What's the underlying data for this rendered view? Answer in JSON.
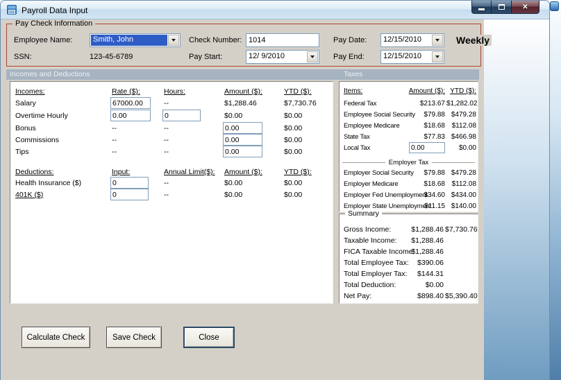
{
  "window": {
    "title": "Payroll Data Input"
  },
  "colors": {
    "form_background": "#d4d0c8",
    "paycheck_group_border": "#a94432",
    "section_header_background": "#a6b4c1",
    "combo_selection": "#2e5cc5"
  },
  "paycheck": {
    "group_label": "Pay Check Information",
    "employee_name": {
      "label": "Employee Name:",
      "value": "Smith, John"
    },
    "ssn": {
      "label": "SSN:",
      "value": "123-45-6789"
    },
    "check_number": {
      "label": "Check Number:",
      "value": "1014"
    },
    "pay_start": {
      "label": "Pay Start:",
      "value": "12/ 9/2010"
    },
    "pay_date": {
      "label": "Pay Date:",
      "value": "12/15/2010"
    },
    "pay_end": {
      "label": "Pay End:",
      "value": "12/15/2010"
    },
    "frequency": "Weekly"
  },
  "section_headers": {
    "incomes_deductions": "Incomes and Deductions",
    "taxes": "Taxes"
  },
  "incomes": {
    "col_headers": {
      "name": "Incomes:",
      "rate": "Rate ($):",
      "hours": "Hours:",
      "amount": "Amount ($):",
      "ytd": "YTD ($):"
    },
    "salary": {
      "label": "Salary",
      "rate": "67000.00",
      "hours": "--",
      "amount": "$1,288.46",
      "ytd": "$7,730.76"
    },
    "overtime": {
      "label": "Overtime Hourly",
      "rate": "0.00",
      "hours": "0",
      "amount": "$0.00",
      "ytd": "$0.00"
    },
    "bonus": {
      "label": "Bonus",
      "rate": "--",
      "hours": "--",
      "amount": "0.00",
      "ytd": "$0.00"
    },
    "commissions": {
      "label": "Commissions",
      "rate": "--",
      "hours": "--",
      "amount": "0.00",
      "ytd": "$0.00"
    },
    "tips": {
      "label": "Tips",
      "rate": "--",
      "hours": "--",
      "amount": "0.00",
      "ytd": "$0.00"
    }
  },
  "deductions": {
    "col_headers": {
      "name": "Deductions:",
      "input": "Input:",
      "limit": "Annual Limit($):",
      "amount": "Amount ($):",
      "ytd": "YTD ($):"
    },
    "health_insurance": {
      "label": "Health Insurance  ($)",
      "input": "0",
      "limit": "--",
      "amount": "$0.00",
      "ytd": "$0.00"
    },
    "k401": {
      "label": "401K  ($)",
      "input": "0",
      "limit": "--",
      "amount": "$0.00",
      "ytd": "$0.00"
    }
  },
  "taxes": {
    "col_headers": {
      "items": "Items:",
      "amount": "Amount ($):",
      "ytd": "YTD ($):"
    },
    "employee_rows": [
      {
        "label": "Federal Tax",
        "amount": "$213.67",
        "ytd": "$1,282.02"
      },
      {
        "label": "Employee Social Security",
        "amount": "$79.88",
        "ytd": "$479.28"
      },
      {
        "label": "Employee Medicare",
        "amount": "$18.68",
        "ytd": "$112.08"
      },
      {
        "label": "State Tax",
        "amount": "$77.83",
        "ytd": "$466.98"
      }
    ],
    "local_tax": {
      "label": "Local Tax",
      "amount": "0.00",
      "ytd": "$0.00"
    },
    "employer_group_label": "Employer Tax",
    "employer_rows": [
      {
        "label": "Employer Social Security",
        "amount": "$79.88",
        "ytd": "$479.28"
      },
      {
        "label": "Employer Medicare",
        "amount": "$18.68",
        "ytd": "$112.08"
      },
      {
        "label": "Employer Fed Unemployment",
        "amount": "$34.60",
        "ytd": "$434.00"
      },
      {
        "label": "Employer State Unemployment",
        "amount": "$11.15",
        "ytd": "$140.00"
      }
    ]
  },
  "summary": {
    "group_label": "Summary",
    "rows": [
      {
        "label": "Gross Income:",
        "amount": "$1,288.46",
        "ytd": "$7,730.76"
      },
      {
        "label": "Taxable Income:",
        "amount": "$1,288.46",
        "ytd": ""
      },
      {
        "label": "FICA Taxable Income:",
        "amount": "$1,288.46",
        "ytd": ""
      },
      {
        "label": "Total Employee Tax:",
        "amount": "$390.06",
        "ytd": ""
      },
      {
        "label": "Total Employer Tax:",
        "amount": "$144.31",
        "ytd": ""
      },
      {
        "label": "Total Deduction:",
        "amount": "$0.00",
        "ytd": ""
      },
      {
        "label": "Net Pay:",
        "amount": "$898.40",
        "ytd": "$5,390.40"
      }
    ]
  },
  "buttons": {
    "calculate": "Calculate Check",
    "save": "Save Check",
    "close": "Close"
  }
}
